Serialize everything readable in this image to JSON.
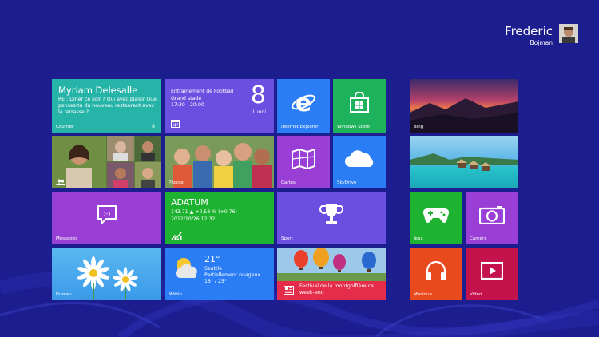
{
  "user": {
    "first_name": "Frederic",
    "last_name": "Bojman"
  },
  "tiles": {
    "mail": {
      "sender": "Myriam Delesalle",
      "preview": "RE : Diner ce soir ? Qui avec plaisir Que penses-tu du nouveau restaurant avec la terrasse ?",
      "label": "Courrier",
      "count": "8",
      "color": "#27b4a8"
    },
    "calendar": {
      "event": "Entrainement de Football",
      "location": "Grand stade",
      "time": "17:30 - 20:00",
      "day_number": "8",
      "day_name": "Lundi",
      "color": "#6b4fe0"
    },
    "ie": {
      "label": "Internet Explorer",
      "color": "#2a7df5"
    },
    "store": {
      "label": "Windows Store",
      "color": "#1db25b"
    },
    "bing": {
      "label": "Bing"
    },
    "people": {
      "label": ""
    },
    "photos": {
      "label": "Photos"
    },
    "maps": {
      "label": "Cartes",
      "color": "#9a3fd5"
    },
    "skydrive": {
      "label": "SkyDrive",
      "color": "#2a7df5"
    },
    "travel": {
      "label": ""
    },
    "messages": {
      "label": "Messages",
      "color": "#9a3fd5"
    },
    "finance": {
      "symbol": "ADATUM",
      "change": "143.71 ▲ +0.53 % (+0.76)",
      "datetime": "2012/10/26 12:32",
      "label": "",
      "color": "#1db22f"
    },
    "sport": {
      "label": "Sport",
      "color": "#6b4fe0"
    },
    "games": {
      "label": "Jeux",
      "color": "#1db22f"
    },
    "camera": {
      "label": "Caméra",
      "color": "#9a3fd5"
    },
    "desktop": {
      "label": "Bureau"
    },
    "weather": {
      "temperature": "21°",
      "city": "Seattle",
      "condition": "Partiellement nuageux",
      "range": "16° / 25°",
      "label": "Météo",
      "color": "#2a7df5"
    },
    "news": {
      "caption": "Festival de la montgolfière ce week-end",
      "color": "#e52c4b"
    },
    "music": {
      "label": "Musique",
      "color": "#e8491d"
    },
    "video": {
      "label": "Vidéo",
      "color": "#c4124c"
    }
  },
  "background_color": "#1c1d8f"
}
